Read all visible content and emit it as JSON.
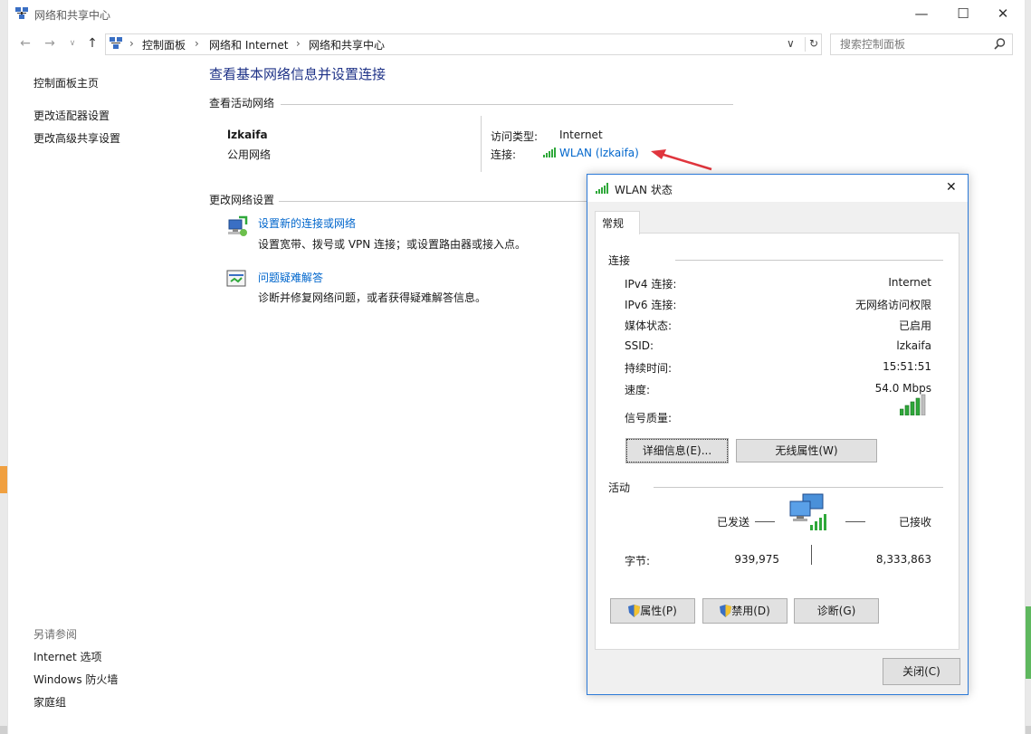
{
  "window": {
    "title": "网络和共享中心",
    "minimize": "—",
    "maximize": "☐",
    "close": "✕"
  },
  "address": {
    "crumbs": [
      "控制面板",
      "网络和 Internet",
      "网络和共享中心"
    ],
    "search_placeholder": "搜索控制面板"
  },
  "sidebar": {
    "items": [
      "控制面板主页",
      "更改适配器设置",
      "更改高级共享设置"
    ],
    "see_also_title": "另请参阅",
    "see_also": [
      "Internet 选项",
      "Windows 防火墙",
      "家庭组"
    ]
  },
  "main": {
    "heading": "查看基本网络信息并设置连接",
    "active_networks_title": "查看活动网络",
    "network_name": "lzkaifa",
    "network_type": "公用网络",
    "access_type_label": "访问类型:",
    "access_type_value": "Internet",
    "connection_label": "连接:",
    "connection_value": "WLAN (lzkaifa)",
    "change_settings_title": "更改网络设置",
    "tasks": [
      {
        "title": "设置新的连接或网络",
        "desc": "设置宽带、拨号或 VPN 连接；或设置路由器或接入点。"
      },
      {
        "title": "问题疑难解答",
        "desc": "诊断并修复网络问题，或者获得疑难解答信息。"
      }
    ]
  },
  "dialog": {
    "title": "WLAN 状态",
    "tab": "常规",
    "connection_group": "连接",
    "rows": [
      {
        "label": "IPv4 连接:",
        "value": "Internet"
      },
      {
        "label": "IPv6 连接:",
        "value": "无网络访问权限"
      },
      {
        "label": "媒体状态:",
        "value": "已启用"
      },
      {
        "label": "SSID:",
        "value": "lzkaifa"
      },
      {
        "label": "持续时间:",
        "value": "15:51:51"
      },
      {
        "label": "速度:",
        "value": "54.0 Mbps"
      }
    ],
    "signal_label": "信号质量:",
    "details_button": "详细信息(E)...",
    "wireless_button": "无线属性(W)",
    "activity_group": "活动",
    "sent_label": "已发送",
    "received_label": "已接收",
    "bytes_label": "字节:",
    "bytes_sent": "939,975",
    "bytes_received": "8,333,863",
    "properties_button": "属性(P)",
    "disable_button": "禁用(D)",
    "diagnose_button": "诊断(G)",
    "close_button": "关闭(C)",
    "close_x": "✕"
  },
  "colors": {
    "link": "#0066cc",
    "heading": "#1e3287",
    "dialog_border": "#2b79d8",
    "arrow": "#e0353d",
    "signal": "#2fa83a"
  }
}
